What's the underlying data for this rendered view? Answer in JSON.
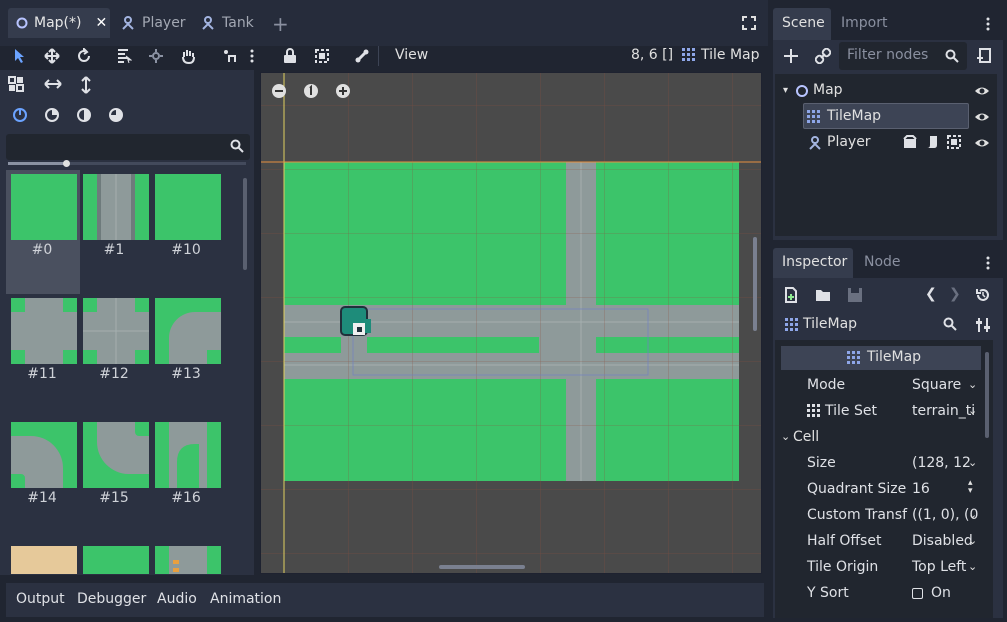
{
  "tabs": {
    "map": "Map(*)",
    "player": "Player",
    "tank": "Tank"
  },
  "toolbar": {
    "view": "View",
    "coords": "8, 6 []",
    "tilemap": "Tile Map"
  },
  "palette": {
    "search_placeholder": "",
    "tiles": [
      "#0",
      "#1",
      "#10",
      "#11",
      "#12",
      "#13",
      "#14",
      "#15",
      "#16"
    ]
  },
  "scene": {
    "tab_scene": "Scene",
    "tab_import": "Import",
    "filter_placeholder": "Filter nodes",
    "nodes": [
      "Map",
      "TileMap",
      "Player"
    ]
  },
  "inspector": {
    "tab_inspector": "Inspector",
    "tab_node": "Node",
    "object": "TileMap",
    "section_header": "TileMap",
    "props": [
      {
        "name": "Mode",
        "value": "Square"
      },
      {
        "name": "Tile Set",
        "value": "terrain_ti"
      },
      {
        "name": "Size",
        "value": "(128, 12"
      },
      {
        "name": "Quadrant Size",
        "value": "16"
      },
      {
        "name": "Custom Transf",
        "value": "((1, 0), (0"
      },
      {
        "name": "Half Offset",
        "value": "Disabled"
      },
      {
        "name": "Tile Origin",
        "value": "Top Left"
      },
      {
        "name": "Y Sort",
        "value": "On"
      }
    ],
    "cell_section": "Cell"
  },
  "bottom": {
    "output": "Output",
    "debugger": "Debugger",
    "audio": "Audio",
    "animation": "Animation"
  },
  "colors": {
    "grass": "#3cc46a",
    "road": "#8e9a9a",
    "accent": "#6ba3ff"
  }
}
